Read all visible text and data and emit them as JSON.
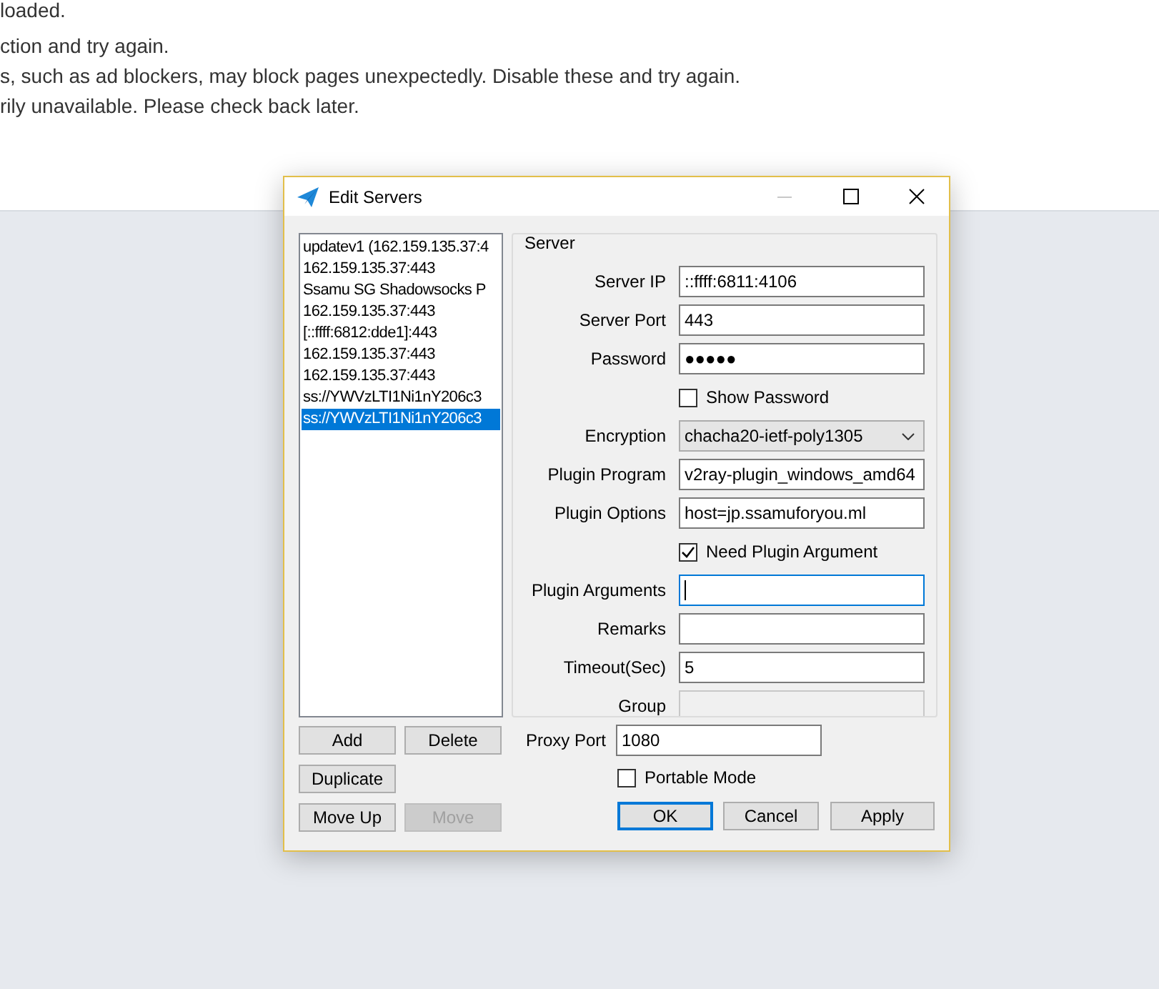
{
  "page_messages": [
    "loaded.",
    "ction and try again.",
    "s, such as ad blockers, may block pages unexpectedly. Disable these and try again.",
    "rily unavailable. Please check back later."
  ],
  "window": {
    "title": "Edit Servers"
  },
  "server_list": {
    "items": [
      {
        "label": "updatev1 (162.159.135.37:4",
        "selected": false
      },
      {
        "label": "162.159.135.37:443",
        "selected": false
      },
      {
        "label": "Ssamu SG Shadowsocks P",
        "selected": false
      },
      {
        "label": "162.159.135.37:443",
        "selected": false
      },
      {
        "label": "[::ffff:6812:dde1]:443",
        "selected": false
      },
      {
        "label": "162.159.135.37:443",
        "selected": false
      },
      {
        "label": "162.159.135.37:443",
        "selected": false
      },
      {
        "label": "ss://YWVzLTI1Ni1nY206c3",
        "selected": false
      },
      {
        "label": "ss://YWVzLTI1Ni1nY206c3",
        "selected": true
      }
    ]
  },
  "list_buttons": [
    {
      "label": "Add",
      "disabled": false
    },
    {
      "label": "Delete",
      "disabled": false
    },
    {
      "label": "Duplicate",
      "disabled": false
    },
    {
      "label": "Move Up",
      "disabled": false
    },
    {
      "label": "Move",
      "disabled": true
    }
  ],
  "server_group": {
    "title": "Server",
    "fields": [
      {
        "kind": "text",
        "label": "Server IP",
        "value": "::ffff:6811:4106",
        "focused": false,
        "disabled": false
      },
      {
        "kind": "text",
        "label": "Server Port",
        "value": "443",
        "focused": false,
        "disabled": false
      },
      {
        "kind": "text",
        "label": "Password",
        "value": "●●●●●",
        "focused": false,
        "disabled": false
      },
      {
        "kind": "checkbox",
        "label": "Show Password",
        "checked": false
      },
      {
        "kind": "dropdown",
        "label": "Encryption",
        "value": "chacha20-ietf-poly1305"
      },
      {
        "kind": "text",
        "label": "Plugin Program",
        "value": "v2ray-plugin_windows_amd64",
        "focused": false,
        "disabled": false
      },
      {
        "kind": "text",
        "label": "Plugin Options",
        "value": "host=jp.ssamuforyou.ml",
        "focused": false,
        "disabled": false
      },
      {
        "kind": "checkbox",
        "label": "Need Plugin Argument",
        "checked": true
      },
      {
        "kind": "text",
        "label": "Plugin Arguments",
        "focused": true,
        "disabled": false
      },
      {
        "kind": "text",
        "label": "Remarks",
        "focused": false,
        "disabled": false
      },
      {
        "kind": "text",
        "label": "Timeout(Sec)",
        "value": "5",
        "focused": false,
        "disabled": false
      },
      {
        "kind": "text",
        "label": "Group",
        "focused": false,
        "disabled": true
      }
    ]
  },
  "proxy_port": {
    "label": "Proxy Port",
    "value": "1080"
  },
  "portable_mode": {
    "label": "Portable Mode",
    "checked": false
  },
  "dialog_buttons": [
    {
      "label": "OK",
      "default": true
    },
    {
      "label": "Cancel",
      "default": false
    },
    {
      "label": "Apply",
      "default": false
    }
  ]
}
